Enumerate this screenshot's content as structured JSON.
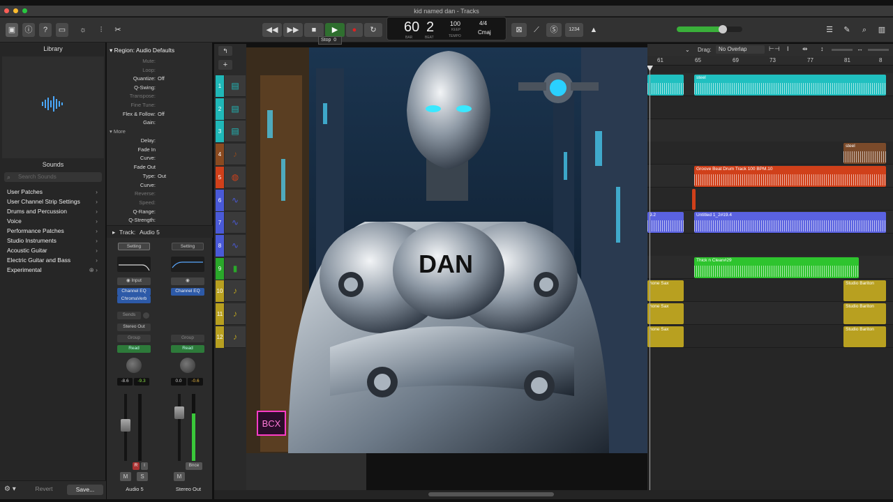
{
  "window": {
    "title": "kid named dan - Tracks"
  },
  "lcd": {
    "bar": "60",
    "beat": "2",
    "bar_label": "BAR",
    "beat_label": "BEAT",
    "tempo": "100",
    "keep": "KEEP",
    "tempo_label": "TEMPO",
    "signature": "4/4",
    "key": "Cmaj"
  },
  "tooltip": {
    "text": "Stop",
    "shortcut": "0"
  },
  "toolbar": {
    "count_in": "1234",
    "drag_label": "Drag:",
    "drag_value": "No Overlap"
  },
  "library": {
    "title": "Library",
    "sounds_title": "Sounds",
    "search_placeholder": "Search Sounds",
    "items": [
      {
        "label": "User Patches"
      },
      {
        "label": "User Channel Strip Settings"
      },
      {
        "label": "Drums and Percussion"
      },
      {
        "label": "Voice"
      },
      {
        "label": "Performance Patches"
      },
      {
        "label": "Studio Instruments"
      },
      {
        "label": "Acoustic Guitar"
      },
      {
        "label": "Electric Guitar and Bass"
      },
      {
        "label": "Experimental"
      }
    ],
    "revert": "Revert",
    "save": "Save..."
  },
  "inspector": {
    "region_header": "Region: Audio Defaults",
    "params": [
      {
        "k": "Mute:",
        "v": "",
        "dim": true
      },
      {
        "k": "Loop:",
        "v": "",
        "dim": true
      },
      {
        "k": "Quantize:",
        "v": "Off"
      },
      {
        "k": "Q-Swing:",
        "v": ""
      },
      {
        "k": "Transpose:",
        "v": "",
        "dim": true
      },
      {
        "k": "Fine Tune:",
        "v": "",
        "dim": true
      },
      {
        "k": "Flex & Follow:",
        "v": "Off"
      },
      {
        "k": "Gain:",
        "v": ""
      }
    ],
    "more_header": "More",
    "more": [
      {
        "k": "Delay:",
        "v": ""
      },
      {
        "k": "Fade In",
        "v": ""
      },
      {
        "k": "Curve:",
        "v": ""
      },
      {
        "k": "Fade Out",
        "v": ""
      },
      {
        "k": "Type:",
        "v": "Out"
      },
      {
        "k": "Curve:",
        "v": ""
      },
      {
        "k": "Reverse:",
        "v": "",
        "dim": true
      },
      {
        "k": "Speed:",
        "v": "",
        "dim": true
      },
      {
        "k": "Q-Range:",
        "v": ""
      },
      {
        "k": "Q-Strength:",
        "v": ""
      }
    ],
    "track_header": "Track:",
    "track_name": "Audio 5"
  },
  "strip1": {
    "setting": "Setting",
    "input": "Input",
    "plugins": [
      "Channel EQ",
      "ChromaVerb"
    ],
    "sends": "Sends",
    "output": "Stereo Out",
    "group": "Group",
    "automation": "Read",
    "vol": "-8.6",
    "peak": "-9.3",
    "r": "R",
    "i": "I",
    "m": "M",
    "s": "S",
    "name": "Audio 5"
  },
  "strip2": {
    "setting": "Setting",
    "plugins": [
      "Channel EQ"
    ],
    "group": "Group",
    "automation": "Read",
    "vol": "0.0",
    "peak": "-0.6",
    "bnce": "Bnce",
    "m": "M",
    "name": "Stereo Out"
  },
  "tracks": [
    {
      "num": "1",
      "color": "#20b8b8",
      "icon": "▤"
    },
    {
      "num": "2",
      "color": "#20b8b8",
      "icon": "▤"
    },
    {
      "num": "3",
      "color": "#20b8b8",
      "icon": "▤"
    },
    {
      "num": "4",
      "color": "#8a4a20",
      "icon": "♪"
    },
    {
      "num": "5",
      "color": "#d0401a",
      "icon": "◍"
    },
    {
      "num": "6",
      "color": "#4a5ad8",
      "icon": "∿"
    },
    {
      "num": "7",
      "color": "#4a5ad8",
      "icon": "∿"
    },
    {
      "num": "8",
      "color": "#4a5ad8",
      "icon": "∿"
    },
    {
      "num": "9",
      "color": "#2aa82a",
      "icon": "▮"
    },
    {
      "num": "10",
      "color": "#b8a020",
      "icon": "♪"
    },
    {
      "num": "11",
      "color": "#b8a020",
      "icon": "♪"
    },
    {
      "num": "12",
      "color": "#b8a020",
      "icon": "♪"
    }
  ],
  "ruler": [
    "61",
    "65",
    "69",
    "73",
    "77",
    "81",
    "8"
  ],
  "regions": {
    "steel1": "steel",
    "steel2": "steel",
    "groove": "Groove Beat Drum Track 100 BPM.10",
    "untitled_a": "9.2",
    "untitled_b": "Untitled 1_2#19.4",
    "thick": "Thick n Clean#29",
    "sax1": "hone Sax",
    "sax2": "hone Sax",
    "sax3": "hone Sax",
    "bari1": "Studio Bariton",
    "bari2": "Studio Bariton",
    "bari3": "Studio Bariton"
  },
  "overlay_image": {
    "chest_text": "DAN",
    "sign_text": "BCX"
  },
  "colors": {
    "cyan": "#20c8c8",
    "orange": "#d0401a",
    "blue": "#5a62e0",
    "green": "#2ec42e",
    "gold": "#b8a020",
    "brown": "#7a4a2a"
  }
}
